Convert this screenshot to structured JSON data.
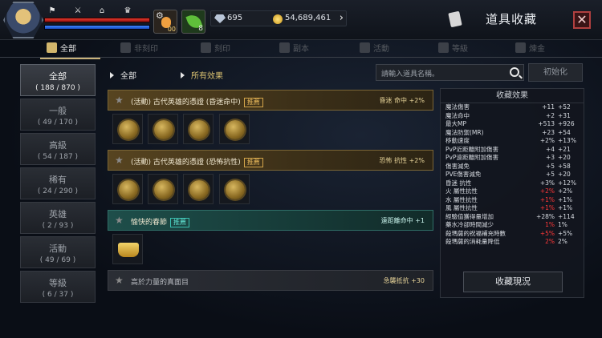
{
  "header": {
    "title": "道具收藏",
    "gems": "695",
    "gold": "54,689,461",
    "potion_count": "00",
    "buff_count": "8"
  },
  "tabs": [
    {
      "label": "全部",
      "icon": "book-icon",
      "active": true
    },
    {
      "label": "非刻印",
      "icon": "shield-icon"
    },
    {
      "label": "刻印",
      "icon": "seal-icon"
    },
    {
      "label": "副本",
      "icon": "horseshoe-icon"
    },
    {
      "label": "活動",
      "icon": "gift-icon"
    },
    {
      "label": "等級",
      "icon": "level-icon"
    },
    {
      "label": "煉金",
      "icon": "alchemy-icon"
    }
  ],
  "categories": [
    {
      "name": "全部",
      "count": "( 188 / 870 )",
      "active": true
    },
    {
      "name": "一般",
      "count": "( 49 / 170 )"
    },
    {
      "name": "高級",
      "count": "( 54 / 187 )"
    },
    {
      "name": "稀有",
      "count": "( 24 / 290 )"
    },
    {
      "name": "英雄",
      "count": "( 2 / 93 )"
    },
    {
      "name": "活動",
      "count": "( 49 / 69 )"
    },
    {
      "name": "等級",
      "count": "( 6 / 37 )"
    }
  ],
  "filters": {
    "category": "全部",
    "effect": "所有效果"
  },
  "search": {
    "placeholder": "請輸入道具名稱。"
  },
  "reset_label": "初始化",
  "groups": [
    {
      "name": "(活動) 古代英雄的憑證 (昏迷命中)",
      "badge": "推薦",
      "effect": "昏迷 命中 +2%",
      "style": "gold",
      "slots": 4,
      "item": "coin"
    },
    {
      "name": "(活動) 古代英雄的憑證 (恐怖抗性)",
      "badge": "推薦",
      "effect": "恐怖 抗性 +2%",
      "style": "gold",
      "slots": 4,
      "item": "coin"
    },
    {
      "name": "愉快的春節",
      "badge": "推薦",
      "effect": "遠距離命中 +1",
      "style": "teal",
      "slots": 1,
      "item": "ingot"
    },
    {
      "name": "高於力量的真面目",
      "badge": "",
      "effect": "急襲抵抗 +30",
      "style": "gold",
      "slots": 0,
      "item": ""
    }
  ],
  "panel": {
    "title": "收藏效果",
    "button": "收藏現況",
    "stats": [
      {
        "name": "魔法傷害",
        "a": "+11",
        "b": "+52"
      },
      {
        "name": "魔法命中",
        "a": "+2",
        "b": "+31"
      },
      {
        "name": "最大MP",
        "a": "+513",
        "b": "+926"
      },
      {
        "name": "魔法防禦(MR)",
        "a": "+23",
        "b": "+54"
      },
      {
        "name": "移動速度",
        "a": "+2%",
        "b": "+13%"
      },
      {
        "name": "PvP近距離附加傷害",
        "a": "+4",
        "b": "+21"
      },
      {
        "name": "PvP遠距離附加傷害",
        "a": "+3",
        "b": "+20"
      },
      {
        "name": "傷害減免",
        "a": "+5",
        "b": "+58"
      },
      {
        "name": "PVE傷害減免",
        "a": "+5",
        "b": "+20"
      },
      {
        "name": "昏迷 抗性",
        "a": "+3%",
        "b": "+12%"
      },
      {
        "name": "火 屬性抗性",
        "a": "+2%",
        "b": "+2%",
        "red": true
      },
      {
        "name": "水 屬性抗性",
        "a": "+1%",
        "b": "+1%",
        "red": true
      },
      {
        "name": "風 屬性抗性",
        "a": "+1%",
        "b": "+1%",
        "red": true
      },
      {
        "name": "經驗值獲得量增加",
        "a": "+28%",
        "b": "+114"
      },
      {
        "name": "藥水冷卻時間減少",
        "a": "1%",
        "b": "1%",
        "red": true
      },
      {
        "name": "殺瑪薩的祝福補充時數",
        "a": "+5%",
        "b": "+5%",
        "red": true
      },
      {
        "name": "殺瑪薩的消耗量降低",
        "a": "2%",
        "b": "2%",
        "red": true
      }
    ]
  }
}
